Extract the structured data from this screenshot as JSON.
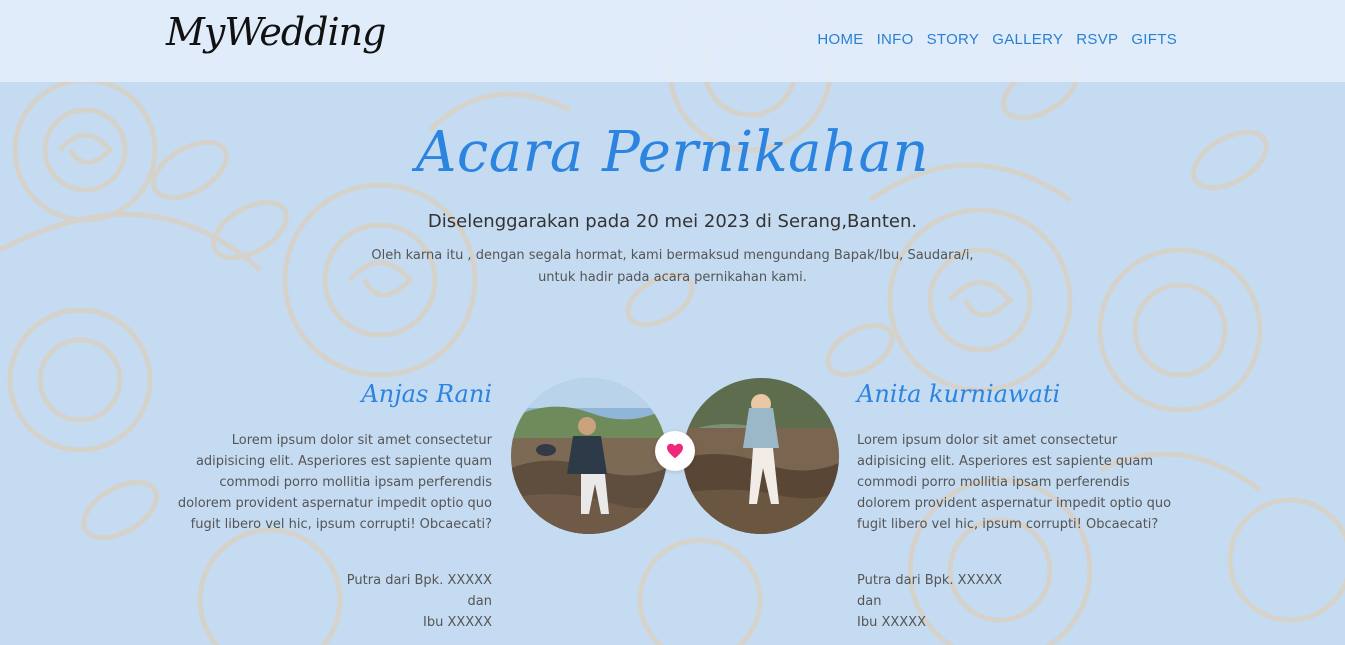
{
  "brand": "MyWedding",
  "nav": [
    "HOME",
    "INFO",
    "STORY",
    "GALLERY",
    "RSVP",
    "GIFTS"
  ],
  "event": {
    "title": "Acara Pernikahan",
    "subtitle": "Diselenggarakan pada 20 mei 2023 di Serang,Banten.",
    "intro_line1": "Oleh karna itu , dengan segala hormat, kami bermaksud mengundang Bapak/Ibu, Saudara/i,",
    "intro_line2": "untuk hadir pada acara pernikahan kami."
  },
  "groom": {
    "name": "Anjas Rani",
    "bio": "Lorem ipsum dolor sit amet consectetur adipisicing elit. Asperiores est sapiente quam commodi porro mollitia ipsam perferendis dolorem provident aspernatur impedit optio quo fugit libero vel hic, ipsum corrupti! Obcaecati?",
    "parents_line1": "Putra dari Bpk. XXXXX",
    "parents_line2": "dan",
    "parents_line3": "Ibu XXXXX"
  },
  "bride": {
    "name": "Anita kurniawati",
    "bio": "Lorem ipsum dolor sit amet consectetur adipisicing elit. Asperiores est sapiente quam commodi porro mollitia ipsam perferendis dolorem provident aspernatur impedit optio quo fugit libero vel hic, ipsum corrupti! Obcaecati?",
    "parents_line1": "Putra dari Bpk. XXXXX",
    "parents_line2": "dan",
    "parents_line3": "Ibu XXXXX"
  },
  "icons": {
    "heart": "heart-icon"
  },
  "colors": {
    "accent": "#2b84e0",
    "background": "#c5dbf1",
    "heart": "#f0287a"
  }
}
